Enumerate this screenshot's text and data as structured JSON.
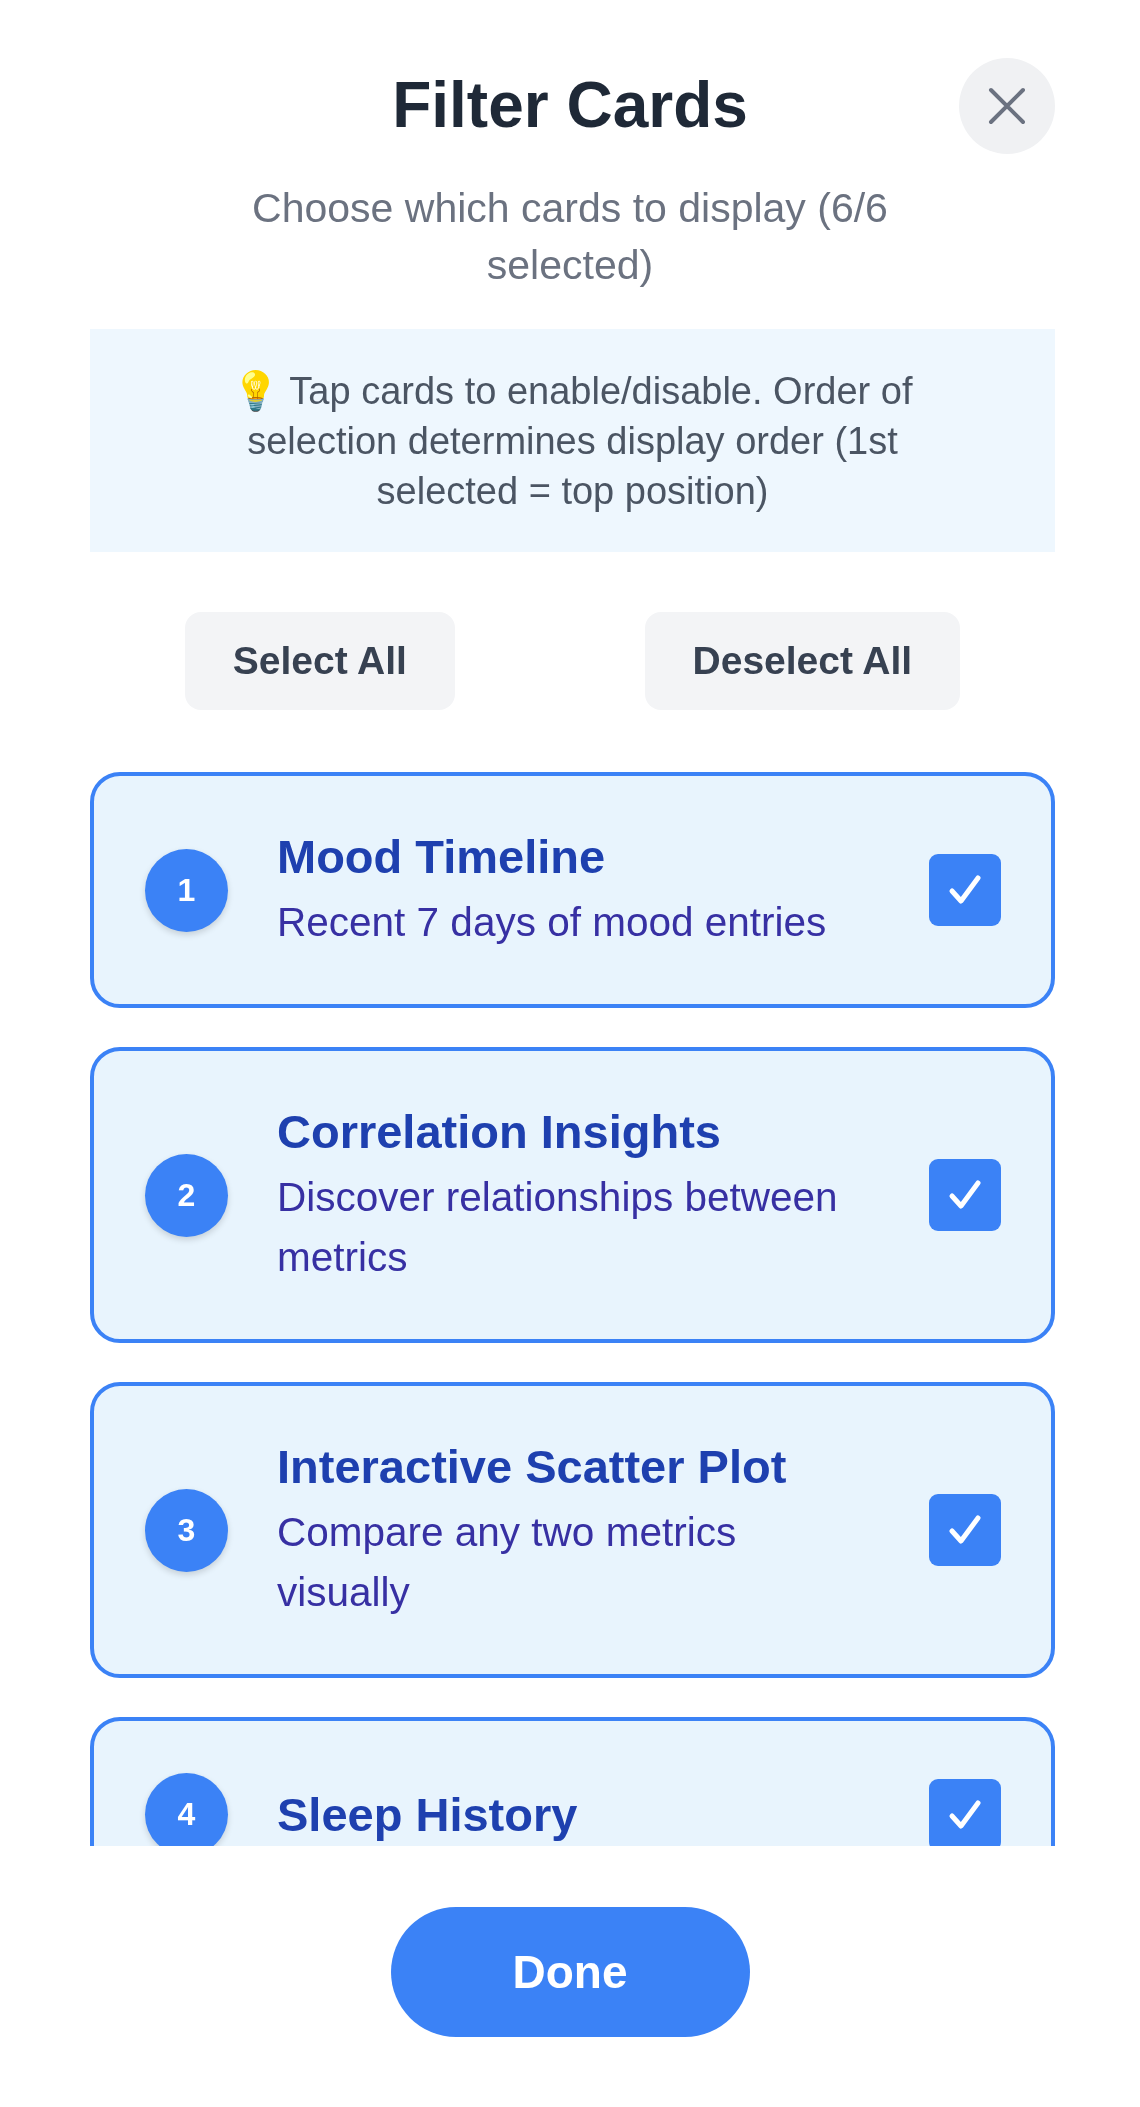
{
  "title": "Filter Cards",
  "subtitle": "Choose which cards to display (6/6 selected)",
  "tip": {
    "text": "💡 Tap cards to enable/disable. Order of selection determines display order (1st selected = top position)"
  },
  "actions": [
    "Select All",
    "Deselect All"
  ],
  "cards": [
    {
      "order": "1",
      "title": "Mood Timeline",
      "description": "Recent 7 days of mood entries",
      "checked": true
    },
    {
      "order": "2",
      "title": "Correlation Insights",
      "description": "Discover relationships between metrics",
      "checked": true
    },
    {
      "order": "3",
      "title": "Interactive Scatter Plot",
      "description": "Compare any two metrics visually",
      "checked": true
    },
    {
      "order": "4",
      "title": "Sleep History",
      "checked": true
    }
  ],
  "done_button": "Done"
}
